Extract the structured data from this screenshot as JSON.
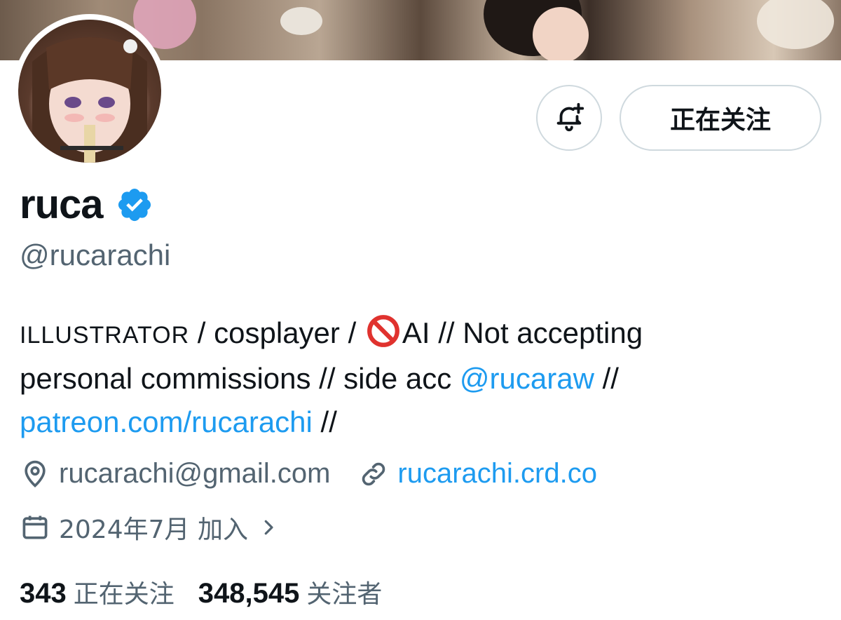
{
  "profile": {
    "name": "ruca",
    "handle": "@rucarachi",
    "verified": true,
    "following_button": "正在关注",
    "bio": {
      "caps": "ILLUSTRATOR",
      "t1": " / cosplayer / ",
      "t2": "AI // Not accepting",
      "t3": "personal commissions // side acc ",
      "mention": "@rucaraw",
      "t4": " //",
      "patreon": "patreon.com/rucarachi",
      "t5": " //"
    },
    "location": "rucarachi@gmail.com",
    "website": "rucarachi.crd.co",
    "joined": "2024年7月 加入",
    "following_count": "343",
    "following_label": "正在关注",
    "followers_count": "348,545",
    "followers_label": "关注者"
  },
  "icons": {
    "bell": "bell-plus-icon",
    "verified": "verified-badge-icon",
    "location": "location-pin-icon",
    "link": "link-icon",
    "calendar": "calendar-icon",
    "chevron": "chevron-right-icon",
    "no_entry": "prohibited-emoji-icon"
  },
  "colors": {
    "link": "#1d9bf0",
    "text": "#0f1419",
    "secondary": "#536471",
    "border": "#cfd9de"
  }
}
